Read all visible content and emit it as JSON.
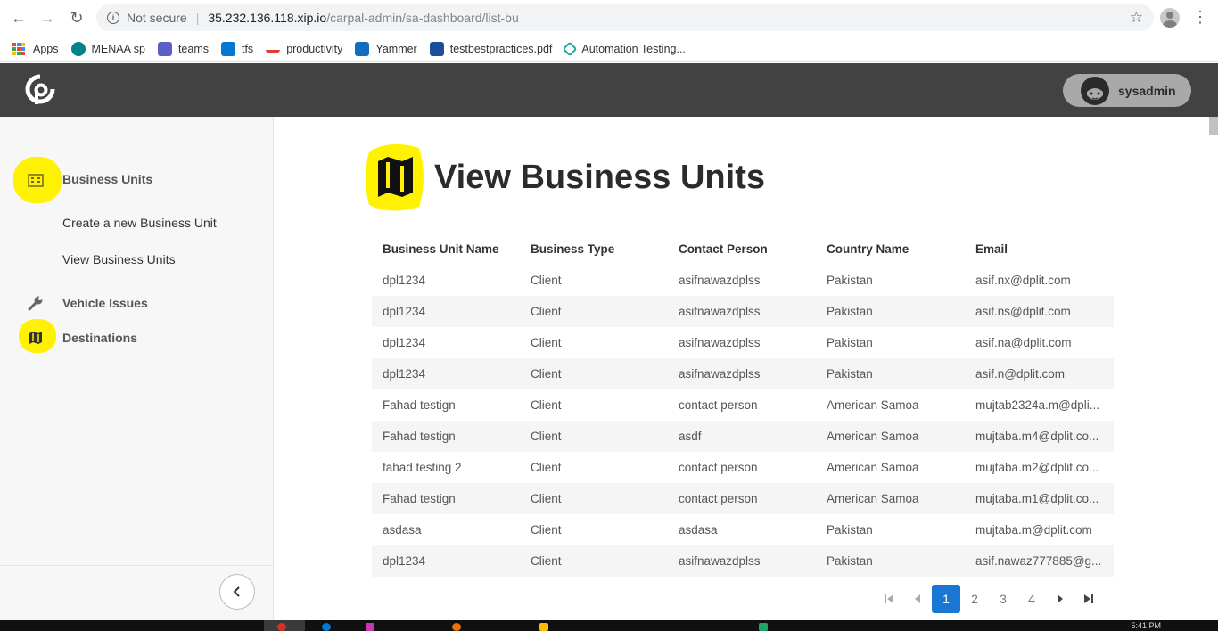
{
  "browser": {
    "security_label": "Not secure",
    "url_host": "35.232.136.118.xip.io",
    "url_path": "/carpal-admin/sa-dashboard/list-bu"
  },
  "bookmarks": [
    {
      "label": "Apps",
      "icon": "apps-grid-icon"
    },
    {
      "label": "MENAA sp",
      "icon": "sharepoint-icon",
      "color": "#038387"
    },
    {
      "label": "teams",
      "icon": "teams-icon",
      "color": "#5b5fc7"
    },
    {
      "label": "tfs",
      "icon": "azure-devops-icon",
      "color": "#0078d4"
    },
    {
      "label": "productivity",
      "icon": "dpl-icon",
      "color": "#e03c31"
    },
    {
      "label": "Yammer",
      "icon": "yammer-icon",
      "color": "#106ebe"
    },
    {
      "label": "testbestpractices.pdf",
      "icon": "pdf-icon",
      "color": "#1b4f9c"
    },
    {
      "label": "Automation Testing...",
      "icon": "automation-icon",
      "color": "#23a4a4"
    }
  ],
  "header": {
    "username": "sysadmin",
    "bg_color": "#424242"
  },
  "sidebar": {
    "groups": [
      {
        "label": "Business Units",
        "icon": "building-icon",
        "items": [
          "Create a new Business Unit",
          "View Business Units"
        ]
      },
      {
        "label": "Vehicle Issues",
        "icon": "wrench-icon"
      },
      {
        "label": "Destinations",
        "icon": "map-icon"
      }
    ]
  },
  "page": {
    "title": "View Business Units",
    "title_icon": "map-icon"
  },
  "table": {
    "columns": [
      "Business Unit Name",
      "Business Type",
      "Contact Person",
      "Country Name",
      "Email"
    ],
    "rows": [
      [
        "dpl1234",
        "Client",
        "asifnawazdplss",
        "Pakistan",
        "asif.nx@dplit.com"
      ],
      [
        "dpl1234",
        "Client",
        "asifnawazdplss",
        "Pakistan",
        "asif.ns@dplit.com"
      ],
      [
        "dpl1234",
        "Client",
        "asifnawazdplss",
        "Pakistan",
        "asif.na@dplit.com"
      ],
      [
        "dpl1234",
        "Client",
        "asifnawazdplss",
        "Pakistan",
        "asif.n@dplit.com"
      ],
      [
        "Fahad testign",
        "Client",
        "contact person",
        "American Samoa",
        "mujtab2324a.m@dpli..."
      ],
      [
        "Fahad testign",
        "Client",
        "asdf",
        "American Samoa",
        "mujtaba.m4@dplit.co..."
      ],
      [
        "fahad testing 2",
        "Client",
        "contact person",
        "American Samoa",
        "mujtaba.m2@dplit.co..."
      ],
      [
        "Fahad testign",
        "Client",
        "contact person",
        "American Samoa",
        "mujtaba.m1@dplit.co..."
      ],
      [
        "asdasa",
        "Client",
        "asdasa",
        "Pakistan",
        "mujtaba.m@dplit.com"
      ],
      [
        "dpl1234",
        "Client",
        "asifnawazdplss",
        "Pakistan",
        "asif.nawaz777885@g..."
      ]
    ]
  },
  "pagination": {
    "pages": [
      "1",
      "2",
      "3",
      "4"
    ],
    "current": "1",
    "accent": "#1976d2"
  },
  "taskbar": {
    "time": "5:41 PM"
  }
}
